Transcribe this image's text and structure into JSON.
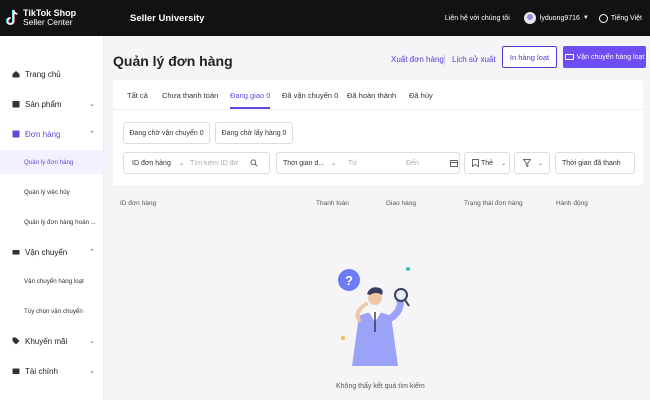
{
  "topbar": {
    "logo_line1": "TikTok Shop",
    "logo_line2": "Seller Center",
    "section": "Seller University",
    "contact": "Liên hệ với chúng tôi",
    "username": "lyduong9716",
    "language": "Tiếng Việt"
  },
  "sidebar": {
    "home": "Trang chủ",
    "products": "Sản phẩm",
    "orders": "Đơn hàng",
    "order_items": [
      "Quản lý đơn hàng",
      "Quản lý việc hủy",
      "Quản lý đơn hàng hoàn ..."
    ],
    "shipping": "Vận chuyển",
    "shipping_items": [
      "Vận chuyển hàng loạt",
      "Tùy chọn vận chuyển"
    ],
    "promotions": "Khuyến mãi",
    "finance": "Tài chính"
  },
  "page": {
    "title": "Quản lý đơn hàng",
    "export": "Xuất đơn hàng",
    "history": "Lịch sử xuất",
    "print_button": "In hàng loạt",
    "ship_button": "Vận chuyển hàng loạt"
  },
  "tabs": [
    "Tất cả",
    "Chưa thanh toán",
    "Đang giao 0",
    "Đã vận chuyển 0",
    "Đã hoàn thành",
    "Đã hủy"
  ],
  "active_tab": "Đang giao 0",
  "chips": [
    "Đang chờ vận chuyển 0",
    "Đang chờ lấy hàng 0"
  ],
  "filters": {
    "order_id_select": "ID đơn hàng",
    "order_id_placeholder": "Tìm kiếm ID đơ",
    "time_select": "Thời gian d...",
    "from_placeholder": "Từ",
    "to_placeholder": "Đến",
    "tag_select": "Thẻ",
    "created_time": "Thời gian đã thanh"
  },
  "table": {
    "columns": [
      "ID đơn hàng",
      "Thanh toán",
      "Giao hàng",
      "Trạng thái đơn hàng",
      "Hành động"
    ]
  },
  "empty_state": {
    "message": "Không thấy kết quả tìm kiếm",
    "icon": "question-mark-magnifier-person-illustration"
  },
  "colors": {
    "accent": "#6448dc",
    "primary_button": "#6c4ef2",
    "topbar": "#121212"
  }
}
